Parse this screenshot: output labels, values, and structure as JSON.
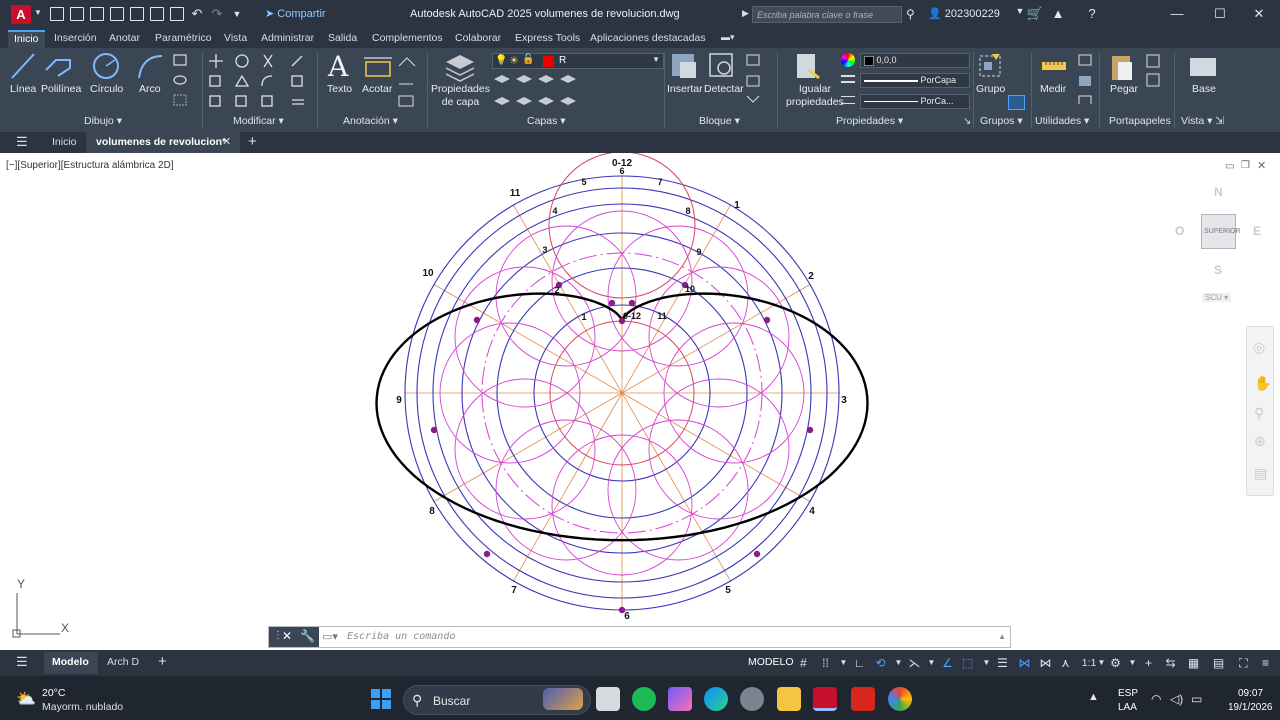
{
  "titlebar": {
    "logo": "A",
    "share_label": "Compartir",
    "title": "Autodesk AutoCAD 2025    volumenes de revolucion.dwg",
    "search_placeholder": "Escriba palabra clave o frase",
    "user": "202300229"
  },
  "ribbon_tabs": [
    "Inicio",
    "Inserción",
    "Anotar",
    "Paramétrico",
    "Vista",
    "Administrar",
    "Salida",
    "Complementos",
    "Colaborar",
    "Express Tools",
    "Aplicaciones destacadas"
  ],
  "ribbon": {
    "dibujo": {
      "title": "Dibujo",
      "tools": [
        "Línea",
        "Polilínea",
        "Círculo",
        "Arco"
      ]
    },
    "modificar": {
      "title": "Modificar"
    },
    "anotacion": {
      "title": "Anotación",
      "tools": [
        "Texto",
        "Acotar"
      ]
    },
    "capas": {
      "title": "Capas",
      "props_line1": "Propiedades",
      "props_line2": "de capa",
      "current_layer": "R"
    },
    "bloque": {
      "title": "Bloque",
      "tools": [
        "Insertar",
        "Detectar"
      ]
    },
    "propiedades": {
      "title": "Propiedades",
      "match_line1": "Igualar",
      "match_line2": "propiedades",
      "color": "0,0,0",
      "linetype": "PorCapa",
      "lineweight": "PorCa..."
    },
    "grupos": {
      "title": "Grupos",
      "tool": "Grupo"
    },
    "utilidades": {
      "title": "Utilidades",
      "tool": "Medir"
    },
    "portapapeles": {
      "title": "Portapapeles",
      "tool": "Pegar"
    },
    "vista": {
      "title": "Vista",
      "tool": "Base"
    }
  },
  "doc_tabs": {
    "home": "Inicio",
    "active": "volumenes de revolucion*"
  },
  "viewport": {
    "label": "[−][Superior][Estructura alámbrica 2D]",
    "viewcube": {
      "top_face": "SUPERIOR",
      "north": "N",
      "south": "S",
      "east": "E",
      "west": "O",
      "ucs": "SCU"
    },
    "ucs_y": "Y",
    "ucs_x": "X"
  },
  "drawing_labels": {
    "outer": [
      "0-12",
      "1",
      "2",
      "3",
      "4",
      "5",
      "6",
      "7",
      "8",
      "9",
      "10",
      "11"
    ],
    "top_small": [
      "6",
      "5",
      "7",
      "4",
      "8",
      "3",
      "9",
      "2",
      "10",
      "1",
      "0-12",
      "11"
    ]
  },
  "command_line": {
    "placeholder": "Escriba un comando"
  },
  "statusbar": {
    "tabs": [
      "Modelo",
      "Arch D"
    ],
    "mode": "MODELO",
    "scale": "1:1"
  },
  "taskbar": {
    "weather_temp": "20°C",
    "weather_desc": "Mayorm. nublado",
    "search": "Buscar",
    "lang1": "ESP",
    "lang2": "LAA",
    "time": "09:07",
    "date": "19/1/2026"
  },
  "colors": {
    "accent": "#4ba2ff",
    "curve": "#000000",
    "blue_circles": "#3b35b8",
    "magenta_circles": "#d640d6",
    "red_circles": "#d8455a",
    "radials": "#e08a4a"
  }
}
